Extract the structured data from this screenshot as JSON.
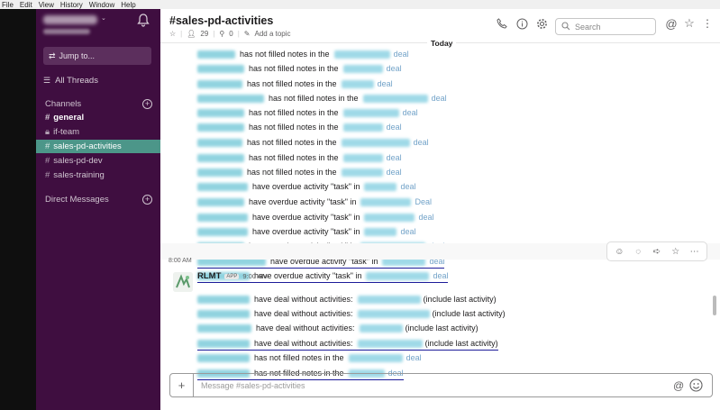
{
  "menubar": [
    "File",
    "Edit",
    "View",
    "History",
    "Window",
    "Help"
  ],
  "sidebar": {
    "jump_label": "Jump to...",
    "all_threads": "All Threads",
    "channels_header": "Channels",
    "channels": [
      {
        "name": "general",
        "bold": true,
        "active": false,
        "icon": "#"
      },
      {
        "name": "if-team",
        "bold": false,
        "active": false,
        "icon": "lock"
      },
      {
        "name": "sales-pd-activities",
        "bold": false,
        "active": true,
        "icon": "#"
      },
      {
        "name": "sales-pd-dev",
        "bold": false,
        "active": false,
        "icon": "#"
      },
      {
        "name": "sales-training",
        "bold": false,
        "active": false,
        "icon": "#"
      }
    ],
    "dm_header": "Direct Messages"
  },
  "header": {
    "title": "#sales-pd-activities",
    "members": "29",
    "pins": "0",
    "add_topic": "Add a topic",
    "search_placeholder": "Search"
  },
  "divider_label": "Today",
  "messages_block1": [
    {
      "text": "has not filled notes in the",
      "suffix": "deal"
    },
    {
      "text": "has not filled notes in the",
      "suffix": "deal"
    },
    {
      "text": "has not filled notes in the",
      "suffix": "deal"
    },
    {
      "text": "has not filled notes in the",
      "suffix": "deal"
    },
    {
      "text": "has not filled notes in the",
      "suffix": "deal"
    },
    {
      "text": "has not filled notes in the",
      "suffix": "deal"
    },
    {
      "text": "has not filled notes in the",
      "suffix": "deal"
    },
    {
      "text": "has not filled notes in the",
      "suffix": "deal"
    },
    {
      "text": "has not filled notes in the",
      "suffix": "deal"
    },
    {
      "text": "have overdue activity \"task\" in",
      "suffix": "deal"
    },
    {
      "text": "have overdue activity \"task\" in",
      "suffix": "Deal"
    },
    {
      "text": "have overdue activity \"task\" in",
      "suffix": "deal"
    },
    {
      "text": "have overdue activity \"task\" in",
      "suffix": "deal"
    },
    {
      "text": "have overdue activity \"task\" in",
      "suffix": "deal"
    },
    {
      "text": "have overdue activity \"task\" in",
      "suffix": "deal"
    },
    {
      "text": "have overdue activity \"task\" in",
      "suffix": "deal"
    }
  ],
  "timestamp_left": "8:00 AM",
  "bot": {
    "name": "RLMT",
    "badge": "APP",
    "time": "9:00 AM"
  },
  "messages_block2": [
    {
      "text": "have deal without activities:",
      "tail": "(include last activity)"
    },
    {
      "text": "have deal without activities:",
      "tail": "(include last activity)"
    },
    {
      "text": "have deal without activities:",
      "tail": "(include last activity)"
    },
    {
      "text": "have deal without activities:",
      "tail": "(include last activity)"
    },
    {
      "text": "has not filled notes in the",
      "tail": "deal"
    },
    {
      "text": "has not filled notes in the",
      "tail": "deal"
    }
  ],
  "composer": {
    "placeholder": "Message #sales-pd-activities"
  }
}
